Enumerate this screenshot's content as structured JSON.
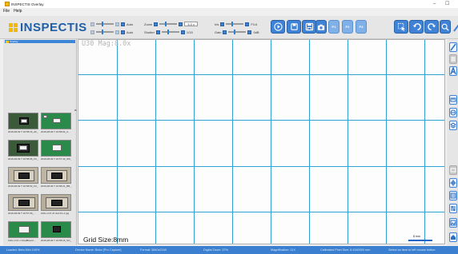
{
  "window": {
    "title": "INSPECTIS Overlay",
    "minimize": "–",
    "maximize": "☐"
  },
  "menu": {
    "file": "File",
    "help": "Help"
  },
  "logo": {
    "text": "INSPECTIS"
  },
  "toolbar": {
    "row1": {
      "auto_label": "Auto",
      "zoom_label": "Zoom",
      "zoom_value": "3.0 x",
      "iris_label": "Iris",
      "iris_value": "F1/4"
    },
    "row2": {
      "auto_label": "Auto",
      "shutter_label": "Shutter",
      "shutter_value": "1/15",
      "gain_label": "Gain",
      "gain_value": "0dB"
    },
    "preset_labels": [
      "P1",
      "P2",
      "P3"
    ]
  },
  "sidebar": {
    "folder_label": "Overlay",
    "thumbnails": [
      {
        "caption": "2016-08-09 T 16:58:16_AF_..."
      },
      {
        "caption": "2016-08-09 T 16:58:04_A..."
      },
      {
        "caption": "2016-08-09 T 16:58:05_FC_..."
      },
      {
        "caption": "2016-08-09 T 16:57:43_WS_..."
      },
      {
        "caption": "2016-08-09 T 16:58:53_FC_..."
      },
      {
        "caption": "2016-08-09 T 16:58:21_BB_..."
      },
      {
        "caption": "2016-08-09 T 16:57:29_..."
      },
      {
        "caption": "100x-x4.5 x0 dvd Fis-1.jpg"
      },
      {
        "caption": "100x-x4.5 x OcadBoard ..."
      },
      {
        "caption": "2016-08-09 T 16:58:15_SO_..."
      }
    ]
  },
  "viewer": {
    "lens_info": "U30 Mag:8.0x",
    "grid_size": "Grid Size:8mm",
    "scale_label": "8 mm"
  },
  "status": {
    "loaded": "Loaded: Beta Mini 100%",
    "device": "Device Name: Bobo [Pro Capture]",
    "format": "Format: 3840x2160",
    "zoom": "Digital Zoom: 37%",
    "magnification": "Magnification: 11X",
    "pixel_size": "Calibrated Pixel Size: 8.4340000 mm",
    "hint": "Select an item to left mouse button"
  },
  "colors": {
    "accent": "#3f82d6",
    "grid": "#2fa3d6",
    "logo": "#1e5fa8",
    "logo_mark": "#f5b800"
  }
}
